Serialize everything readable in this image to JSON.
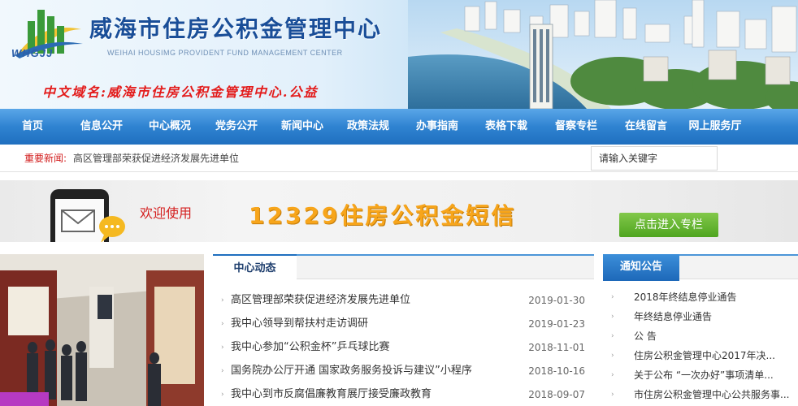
{
  "header": {
    "logo_text": "WHGJJ",
    "title": "威海市住房公积金管理中心",
    "subtitle": "WEIHAI HOUSIMG PROVIDENT FUND MANAGEMENT CENTER",
    "domain_text": "中文域名:威海市住房公积金管理中心.公益"
  },
  "nav": {
    "items": [
      {
        "label": "首页",
        "width": 80
      },
      {
        "label": "信息公开",
        "width": 90
      },
      {
        "label": "中心概况",
        "width": 78
      },
      {
        "label": "党务公开",
        "width": 86
      },
      {
        "label": "新闻中心",
        "width": 76
      },
      {
        "label": "政策法规",
        "width": 86
      },
      {
        "label": "办事指南",
        "width": 84
      },
      {
        "label": "表格下载",
        "width": 86
      },
      {
        "label": "督察专栏",
        "width": 86
      },
      {
        "label": "在线留言",
        "width": 86
      },
      {
        "label": "网上服务厅",
        "width": 84
      }
    ]
  },
  "ticker": {
    "label": "重要新闻:",
    "text": "高区管理部荣获促进经济发展先进单位"
  },
  "search": {
    "placeholder": "请输入关键字"
  },
  "promo": {
    "welcome": "欢迎使用",
    "sms_title": "12329住房公积金短信",
    "button_label": "点击进入专栏"
  },
  "news": {
    "tab_label": "中心动态",
    "items": [
      {
        "title": "高区管理部荣获促进经济发展先进单位",
        "date": "2019-01-30"
      },
      {
        "title": "我中心领导到帮扶村走访调研",
        "date": "2019-01-23"
      },
      {
        "title": "我中心参加“公积金杯”乒乓球比赛",
        "date": "2018-11-01"
      },
      {
        "title": "国务院办公厅开通 国家政务服务投诉与建议”小程序",
        "date": "2018-10-16"
      },
      {
        "title": "我中心到市反腐倡廉教育展厅接受廉政教育",
        "date": "2018-09-07"
      }
    ]
  },
  "notice": {
    "tab_label": "通知公告",
    "items": [
      {
        "title": "2018年终结息停业通告"
      },
      {
        "title": "年终结息停业通告"
      },
      {
        "title": "公 告"
      },
      {
        "title": "住房公积金管理中心2017年决..."
      },
      {
        "title": "关于公布 “一次办好”事项清单..."
      },
      {
        "title": "市住房公积金管理中心公共服务事..."
      }
    ]
  },
  "colors": {
    "nav_blue": "#2f83d1",
    "title_blue": "#1a4e98",
    "accent_red": "#e31b1b",
    "promo_orange": "#f7a51b",
    "promo_green": "#4fa520"
  }
}
